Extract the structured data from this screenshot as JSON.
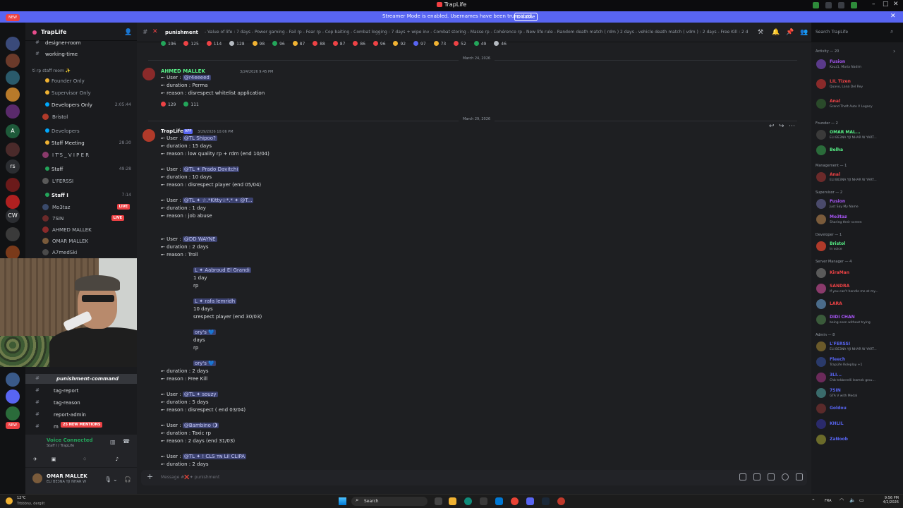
{
  "window": {
    "title": "TrapLife"
  },
  "banner": {
    "text": "Streamer Mode is enabled. Usernames have been truncated.",
    "button": "Disable"
  },
  "rail": {
    "new_badge": "NEW",
    "labels": [
      "A",
      "rs",
      "CW"
    ],
    "counts": [
      "34",
      "75",
      "22",
      "100",
      "62",
      "210",
      "320",
      "375"
    ]
  },
  "guild": {
    "name": "TrapLife"
  },
  "channels": [
    {
      "label": "designer-room"
    },
    {
      "label": "working-time"
    },
    {
      "label": "ti rp staff room ✨"
    },
    {
      "label": "Founder Only"
    },
    {
      "label": "Supervisor Only"
    },
    {
      "label": "Developers Only",
      "count": "2:05:44"
    },
    {
      "label": "Bristol",
      "user": true
    },
    {
      "label": "Developers"
    },
    {
      "label": "Staff Meeting",
      "count": "28:30"
    },
    {
      "label": "I T'S _ V I P E R",
      "user": true
    },
    {
      "label": "Staff",
      "count": "49:28"
    },
    {
      "label": "L'FERSSI",
      "user": true
    },
    {
      "label": "Staff I",
      "count": "7:14"
    },
    {
      "label": "Mo3taz",
      "user": true,
      "live": "LIVE"
    },
    {
      "label": "7SIN",
      "user": true,
      "live": "LIVE"
    },
    {
      "label": "AHMED MALLEK",
      "user": true
    },
    {
      "label": "OMAR MALLEK",
      "user": true
    },
    {
      "label": "A7medSki",
      "user": true
    }
  ],
  "channels_lower": [
    {
      "label": "punishment"
    },
    {
      "label": "punishment-command"
    },
    {
      "label": "tag-report"
    },
    {
      "label": "tag-reason"
    },
    {
      "label": "report-admin"
    },
    {
      "label": "m",
      "badge": "25 NEW MENTIONS"
    }
  ],
  "voice": {
    "status": "Voice Connected",
    "location": "Staff I / TrapLife"
  },
  "user": {
    "name": "OMAR MALLEK",
    "status": "ELI BE3NA YJI NHAR W"
  },
  "chat": {
    "channel": "punishment",
    "topic": "- Value of life : 7 days - Power gaming - Fail rp - Fear rp - Cop baiting - Combat logging : 7 days + wipe inv - Combat storing - Masse rp - Cohérence rp - New life rule - Random death match ( rdm ) 2 days - vehicle death match ( vdm ) : 2 days - Free Kill : 2 days",
    "search_placeholder": "Search TrapLife",
    "top_reactions": [
      "196",
      "125",
      "114",
      "128",
      "98",
      "96",
      "87",
      "88",
      "87",
      "86",
      "96",
      "92",
      "97",
      "73",
      "52",
      "49",
      "46"
    ],
    "date1": "March 24, 2026",
    "date2": "March 29, 2026",
    "msg1": {
      "author": "AHMED MALLEK",
      "timestamp": "3/24/2026 9:45 PM",
      "lines": [
        {
          "pre": "➸ User : ",
          "mention": "@r4eeeed",
          "post": ""
        },
        {
          "pre": "➸ duration : Perma",
          "mention": "",
          "post": ""
        },
        {
          "pre": "➸ reason : disrespect whitelist application",
          "mention": "",
          "post": ""
        }
      ],
      "reactions": [
        "129",
        "111"
      ]
    },
    "msg2": {
      "author": "TrapLife",
      "tag": "APP",
      "timestamp": "3/29/2026 10:06 PM",
      "lines": [
        {
          "pre": "➸ User : ",
          "mention": "@TL Shipoo?",
          "post": ""
        },
        {
          "pre": "➸ duration : 15 days",
          "mention": "",
          "post": ""
        },
        {
          "pre": "➸ reason : low quality rp + rdm (end 10/04)",
          "mention": "",
          "post": ""
        },
        {
          "pre": "",
          "mention": "",
          "post": ""
        },
        {
          "pre": "➸ User : ",
          "mention": "@TL ✦ Prado Davitchi",
          "post": ""
        },
        {
          "pre": "➸ duration : 10 days",
          "mention": "",
          "post": ""
        },
        {
          "pre": "➸ reason : disrespect player (end 05/04)",
          "mention": "",
          "post": ""
        },
        {
          "pre": "",
          "mention": "",
          "post": ""
        },
        {
          "pre": "➸ User : ",
          "mention": "@TL ✦ ☆.*Kitty☆*.* ✦ @T...",
          "post": ""
        },
        {
          "pre": "➸ duration : 1 day",
          "mention": "",
          "post": ""
        },
        {
          "pre": "➸ reason : job abuse",
          "mention": "",
          "post": ""
        },
        {
          "pre": "",
          "mention": "",
          "post": ""
        },
        {
          "pre": "",
          "mention": "",
          "post": ""
        },
        {
          "pre": "➸ User : ",
          "mention": "@DD WAYNE",
          "post": ""
        },
        {
          "pre": "➸ duration : 2 days",
          "mention": "",
          "post": ""
        },
        {
          "pre": "➸ reason : Troll",
          "mention": "",
          "post": ""
        },
        {
          "pre": "",
          "mention": "",
          "post": ""
        },
        {
          "pre": "",
          "mention": "L ✦ Aabroud El Grandi",
          "post": ""
        },
        {
          "pre": "1 day",
          "mention": "",
          "post": ""
        },
        {
          "pre": "rp",
          "mention": "",
          "post": ""
        },
        {
          "pre": "",
          "mention": "",
          "post": ""
        },
        {
          "pre": "",
          "mention": "L ✦ rafa lemridh",
          "post": ""
        },
        {
          "pre": "10 days",
          "mention": "",
          "post": ""
        },
        {
          "pre": "srespect player (end 30/03)",
          "mention": "",
          "post": ""
        },
        {
          "pre": "",
          "mention": "",
          "post": ""
        },
        {
          "pre": "",
          "mention": "ory's 💙",
          "post": ""
        },
        {
          "pre": "days",
          "mention": "",
          "post": ""
        },
        {
          "pre": "rp",
          "mention": "",
          "post": ""
        },
        {
          "pre": "",
          "mention": "",
          "post": ""
        },
        {
          "pre": "",
          "mention": "ory's 💙",
          "post": ""
        },
        {
          "pre": "➸ duration : 2 days",
          "mention": "",
          "post": ""
        },
        {
          "pre": "➸ reason : Free Kill",
          "mention": "",
          "post": ""
        },
        {
          "pre": "",
          "mention": "",
          "post": ""
        },
        {
          "pre": "➸ User : ",
          "mention": "@TL ✦ souzy",
          "post": ""
        },
        {
          "pre": "➸ duration : 5 days",
          "mention": "",
          "post": ""
        },
        {
          "pre": "➸ reason : disrespect ( end 03/04)",
          "mention": "",
          "post": ""
        },
        {
          "pre": "",
          "mention": "",
          "post": ""
        },
        {
          "pre": "➸ User : ",
          "mention": "@Bambino 🌖",
          "post": ""
        },
        {
          "pre": "➸ duration : Toxic rp",
          "mention": "",
          "post": ""
        },
        {
          "pre": "➸ reason : 2 days (end 31/03)",
          "mention": "",
          "post": ""
        },
        {
          "pre": "",
          "mention": "",
          "post": ""
        },
        {
          "pre": "➸ User : ",
          "mention": "@TL ✦ ! CLS ᴛɴ Lil CLIPA",
          "post": ""
        },
        {
          "pre": "➸ duration : 2 days",
          "mention": "",
          "post": ""
        }
      ]
    },
    "composer_placeholder": "Message #❌✦ punishment"
  },
  "members": {
    "activity": "Activity — 20",
    "items": [
      {
        "kind": "sec",
        "text": ""
      },
      {
        "name": "Fusion",
        "status": "Kouz1, Maria Nadim",
        "color": "#a855f7"
      },
      {
        "name": "LIL Tizen",
        "status": "Quavo, Lana Del Rey",
        "color": "#ed4245"
      },
      {
        "name": "Anal",
        "status": "Grand Theft Auto V Legacy",
        "color": "#ed4245"
      },
      {
        "kind": "sec",
        "text": "Founder — 2"
      },
      {
        "name": "OMAR MAL...",
        "status": "ELI BE3NA YJI NHAR W YART...",
        "color": "#57f287"
      },
      {
        "name": "Belha",
        "status": "",
        "color": "#57f287"
      },
      {
        "kind": "sec",
        "text": "Management — 1"
      },
      {
        "name": "Anal",
        "status": "ELI BE3NA YJI NHAR W YART...",
        "color": "#ed4245"
      },
      {
        "kind": "sec",
        "text": "Supervisor — 2"
      },
      {
        "name": "Fusion",
        "status": "Just Say My Name",
        "color": "#a855f7"
      },
      {
        "name": "Mo3taz",
        "status": "Sharing their screen",
        "color": "#a855f7"
      },
      {
        "kind": "sec",
        "text": "Developer — 1"
      },
      {
        "name": "Bristol",
        "status": "In voice",
        "color": "#57f287"
      },
      {
        "kind": "sec",
        "text": "Server Manager — 4"
      },
      {
        "name": "KiraMan",
        "status": "",
        "color": "#ed4245"
      },
      {
        "name": "SANDRA",
        "status": "If you can't handle me at my...",
        "color": "#ed4245"
      },
      {
        "name": "LARA",
        "status": "",
        "color": "#ed4245"
      },
      {
        "name": "DIDI CHAN",
        "status": "being seen without trying",
        "color": "#a855f7"
      },
      {
        "kind": "sec",
        "text": "Admin — 8"
      },
      {
        "name": "L'FERSSI",
        "status": "ELI BE3NA YJI NHAR W YART...",
        "color": "#5865f2"
      },
      {
        "name": "Fleech",
        "status": "TrapLife Roleplay +1",
        "color": "#5865f2"
      },
      {
        "name": "3LI...",
        "status": "Chb tekberelli lezmek grou...",
        "color": "#5865f2"
      },
      {
        "name": "7SIN",
        "status": "GTA V with Medal",
        "color": "#5865f2"
      },
      {
        "name": "Goldou",
        "status": "",
        "color": "#5865f2"
      },
      {
        "name": "KHLIL",
        "status": "",
        "color": "#5865f2"
      },
      {
        "name": "ZaNoob",
        "status": "",
        "color": "#5865f2"
      }
    ]
  },
  "taskbar": {
    "weather": "12°C",
    "weather_sub": "Trbbbny, dergilt",
    "search": "Search",
    "lang": "FRA",
    "time": "9:56 PM",
    "date": "4/2/2026"
  },
  "colors": {
    "blurple": "#5865f2",
    "red": "#ed4245",
    "green": "#23a55a",
    "gold": "#f0b232"
  }
}
